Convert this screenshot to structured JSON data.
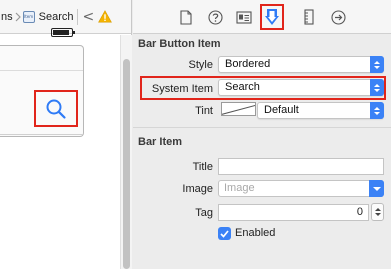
{
  "jumpbar": {
    "truncated_crumb": "ns",
    "item_icon_text": "Item",
    "current_crumb": "Search",
    "back_glyph": "<",
    "warning_icon": "warning-icon"
  },
  "canvas": {
    "battery_icon": "battery-icon",
    "bar_item_icon": "search-icon"
  },
  "inspector_tabs": [
    {
      "icon": "file-icon"
    },
    {
      "icon": "help-icon"
    },
    {
      "icon": "identity-icon"
    },
    {
      "icon": "attributes-icon",
      "selected": true
    },
    {
      "icon": "size-icon"
    },
    {
      "icon": "connections-icon"
    }
  ],
  "bar_button_item": {
    "title": "Bar Button Item",
    "style_label": "Style",
    "style_value": "Bordered",
    "system_item_label": "System Item",
    "system_item_value": "Search",
    "tint_label": "Tint",
    "tint_value": "Default"
  },
  "bar_item": {
    "title": "Bar Item",
    "title_label": "Title",
    "title_value": "",
    "image_label": "Image",
    "image_placeholder": "Image",
    "tag_label": "Tag",
    "tag_value": "0",
    "enabled_label": "Enabled",
    "enabled_checked": true
  },
  "colors": {
    "highlight": "#e1251b",
    "accent": "#3b82f6",
    "selected_tab": "#2f7bf6"
  }
}
